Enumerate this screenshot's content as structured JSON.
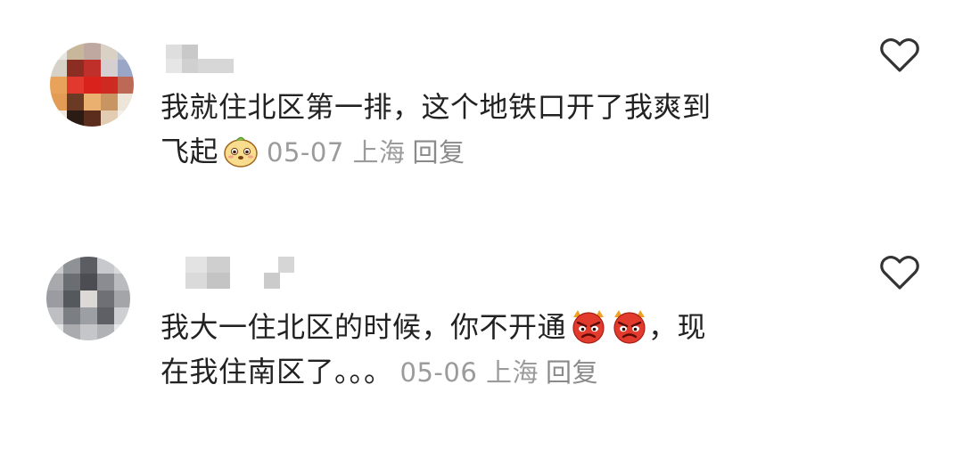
{
  "comments": [
    {
      "lines": [
        "我就住北区第一排，这个地铁口开了我爽到",
        "飞起"
      ],
      "emoji": "smiling-bun-emoji",
      "date": "05-07",
      "location": "上海",
      "reply_label": "回复",
      "like_icon": "heart-outline-icon"
    },
    {
      "lines": [
        "我大一住北区的时候，你不开通",
        "，现",
        "在我住南区了。。。"
      ],
      "emoji": "angry-red-face-emoji",
      "date": "05-06",
      "location": "上海",
      "reply_label": "回复",
      "like_icon": "heart-outline-icon"
    }
  ],
  "colors": {
    "text": "#222222",
    "meta": "#9b9b9b",
    "icon": "#333333"
  }
}
